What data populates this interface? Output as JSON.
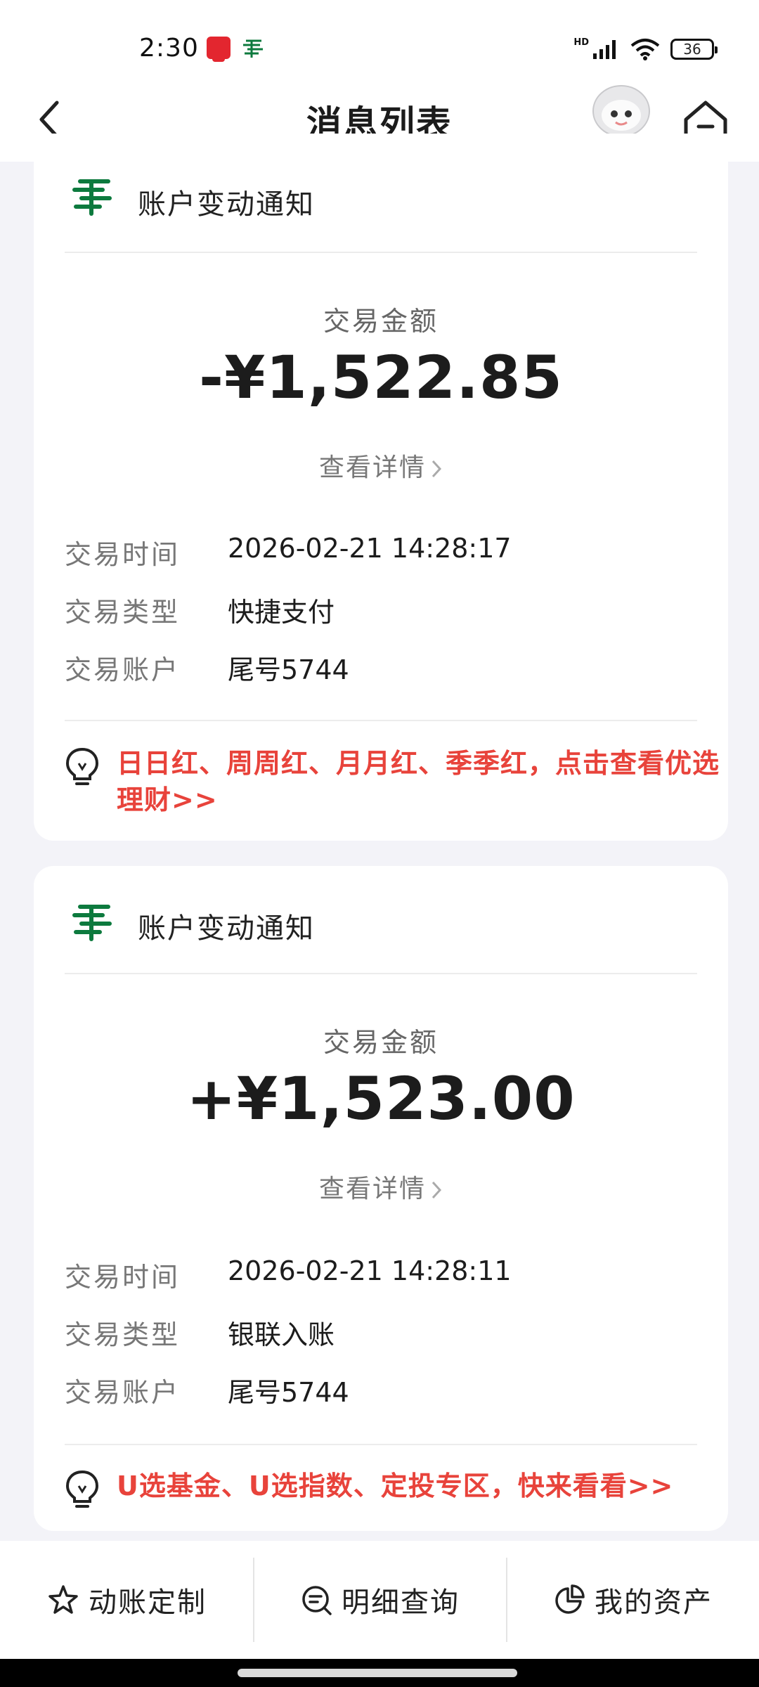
{
  "status_bar": {
    "time": "2:30",
    "network_label": "HD",
    "battery": "36",
    "icons": [
      "notification-app-icon",
      "post-bank-icon",
      "signal-icon",
      "wifi-icon",
      "battery-icon"
    ]
  },
  "header": {
    "title": "消息列表",
    "back_icon": "chevron-left-icon",
    "mascot_icon": "robot-mascot-icon",
    "home_icon": "home-icon"
  },
  "colors": {
    "brand_green": "#0d7a3e",
    "promo_red": "#e8433b",
    "background": "#f3f3f8"
  },
  "messages": [
    {
      "title": "账户变动通知",
      "amount_label": "交易金额",
      "amount": "-¥1,522.85",
      "detail_link": "查看详情",
      "rows": [
        {
          "key": "交易时间",
          "value": "2026-02-21 14:28:17"
        },
        {
          "key": "交易类型",
          "value": "快捷支付"
        },
        {
          "key": "交易账户",
          "value": "尾号5744"
        }
      ],
      "promo": "日日红、周周红、月月红、季季红，点击查看优选理财>>"
    },
    {
      "title": "账户变动通知",
      "amount_label": "交易金额",
      "amount": "+¥1,523.00",
      "detail_link": "查看详情",
      "rows": [
        {
          "key": "交易时间",
          "value": "2026-02-21 14:28:11"
        },
        {
          "key": "交易类型",
          "value": "银联入账"
        },
        {
          "key": "交易账户",
          "value": "尾号5744"
        }
      ],
      "promo": "U选基金、U选指数、定投专区，快来看看>>"
    }
  ],
  "bottom_bar": [
    {
      "label": "动账定制",
      "icon": "star-icon"
    },
    {
      "label": "明细查询",
      "icon": "search-list-icon"
    },
    {
      "label": "我的资产",
      "icon": "pie-chart-icon"
    }
  ]
}
